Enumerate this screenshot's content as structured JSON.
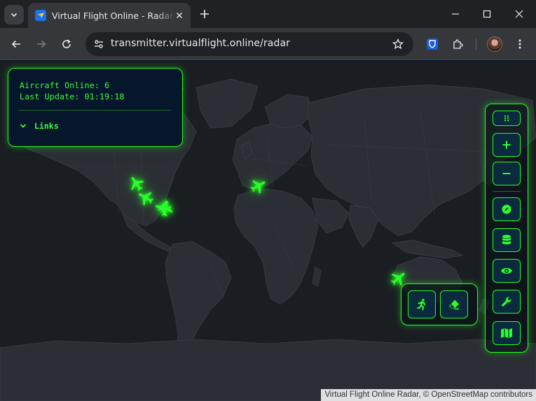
{
  "browser": {
    "tab_title": "Virtual Flight Online - Radar Display",
    "url": "transmitter.virtualflight.online/radar"
  },
  "info_panel": {
    "aircraft_online_label": "Aircraft Online: 6",
    "last_update_label": "Last Update: 01:19:18",
    "links_label": "Links"
  },
  "controls": {
    "side": [
      {
        "id": "drag-handle",
        "icon": "grip-dots-icon"
      },
      {
        "id": "zoom-in",
        "icon": "plus-icon"
      },
      {
        "id": "zoom-out",
        "icon": "minus-icon"
      },
      {
        "id": "compass",
        "icon": "compass-icon"
      },
      {
        "id": "database",
        "icon": "database-icon"
      },
      {
        "id": "visibility",
        "icon": "eye-icon"
      },
      {
        "id": "settings",
        "icon": "wrench-icon"
      },
      {
        "id": "map-layers",
        "icon": "map-icon"
      }
    ],
    "tools": [
      {
        "id": "follow",
        "icon": "running-person-icon"
      },
      {
        "id": "clear-trails",
        "icon": "eraser-icon"
      }
    ]
  },
  "aircraft_count": 6,
  "colors": {
    "accent": "#22ff22",
    "panel_bg": "#06162b",
    "button_bg": "#0a2a3d",
    "map_land": "#2b2f35",
    "map_water": "#1a1d22"
  },
  "attribution": "Virtual Flight Online Radar, © OpenStreetMap contributors"
}
